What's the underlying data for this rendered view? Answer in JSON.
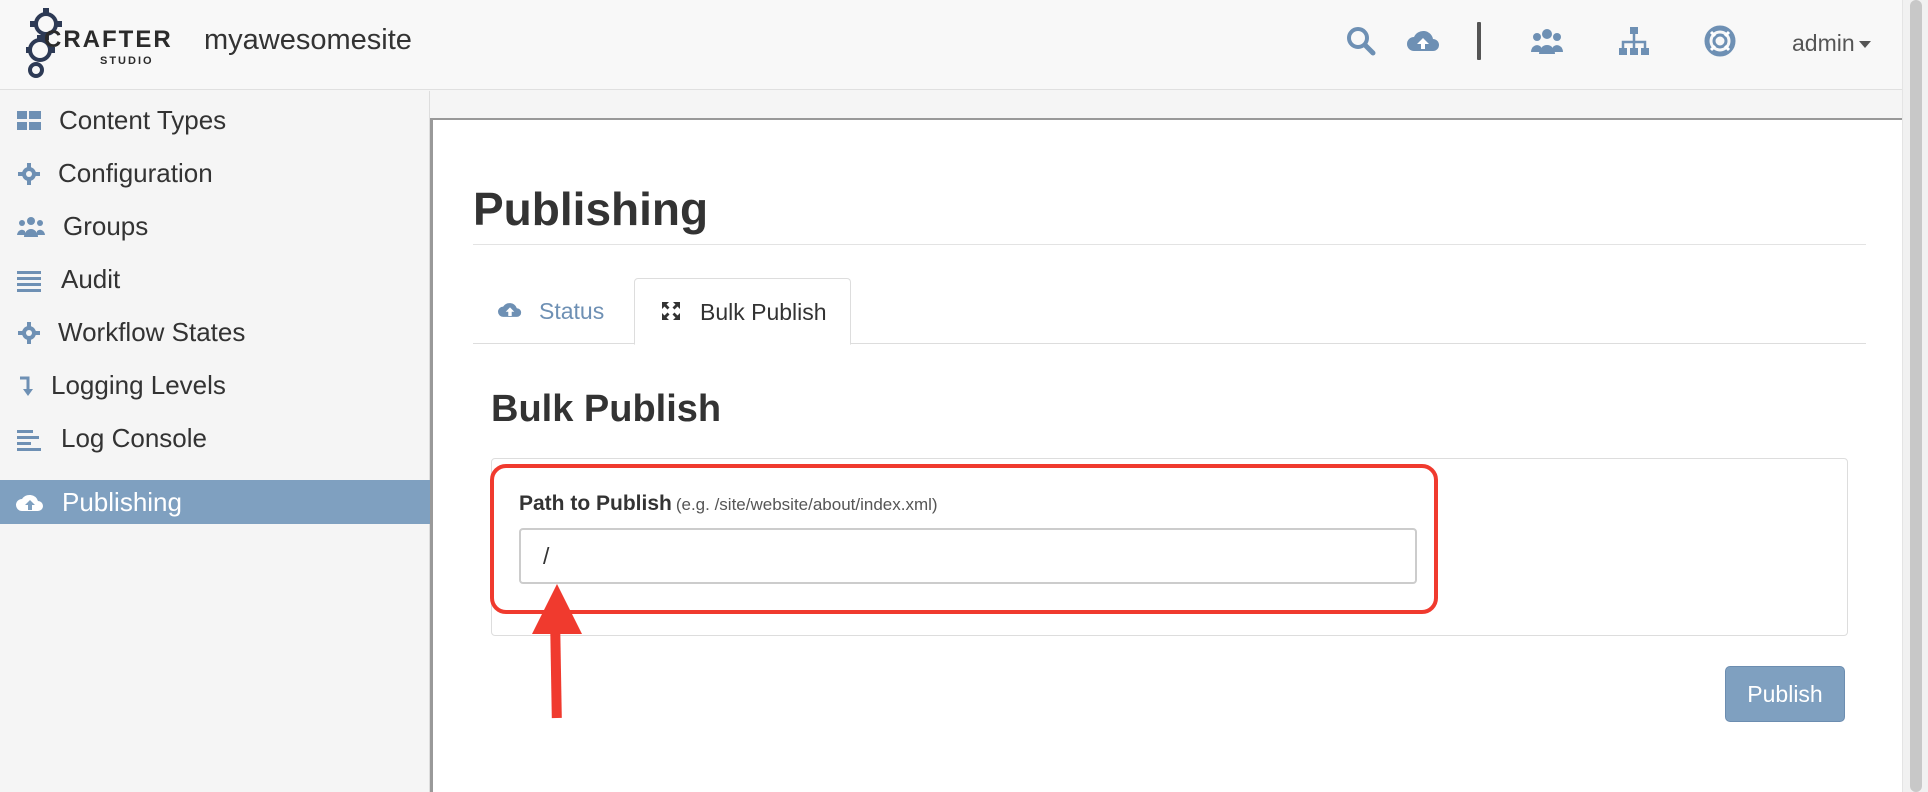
{
  "app": {
    "logo_word": "CRAFTER",
    "logo_sub": "STUDIO",
    "site_name": "myawesomesite"
  },
  "header": {
    "icons": [
      "search-icon",
      "cloud-upload-icon",
      "users-icon",
      "sitemap-icon",
      "lifebuoy-icon"
    ],
    "user_label": "admin"
  },
  "sidebar": {
    "items": [
      {
        "label": "Content Types",
        "icon": "grid-icon"
      },
      {
        "label": "Configuration",
        "icon": "gear-icon"
      },
      {
        "label": "Groups",
        "icon": "users-icon"
      },
      {
        "label": "Audit",
        "icon": "list-icon"
      },
      {
        "label": "Workflow States",
        "icon": "gear-icon"
      },
      {
        "label": "Logging Levels",
        "icon": "level-down-icon"
      },
      {
        "label": "Log Console",
        "icon": "align-left-icon"
      },
      {
        "label": "Publishing",
        "icon": "cloud-upload-icon",
        "active": true
      }
    ]
  },
  "main": {
    "title": "Publishing",
    "tabs": [
      {
        "label": "Status",
        "icon": "cloud-upload-icon"
      },
      {
        "label": "Bulk Publish",
        "icon": "expand-icon",
        "active": true
      }
    ],
    "section_title": "Bulk Publish",
    "form": {
      "path_label": "Path to Publish",
      "path_hint": "(e.g. /site/website/about/index.xml)",
      "path_value": "/"
    },
    "publish_label": "Publish"
  },
  "colors": {
    "accent": "#7fa0c0",
    "tab_link": "#6e90b4",
    "annotation": "#f03a2e"
  }
}
